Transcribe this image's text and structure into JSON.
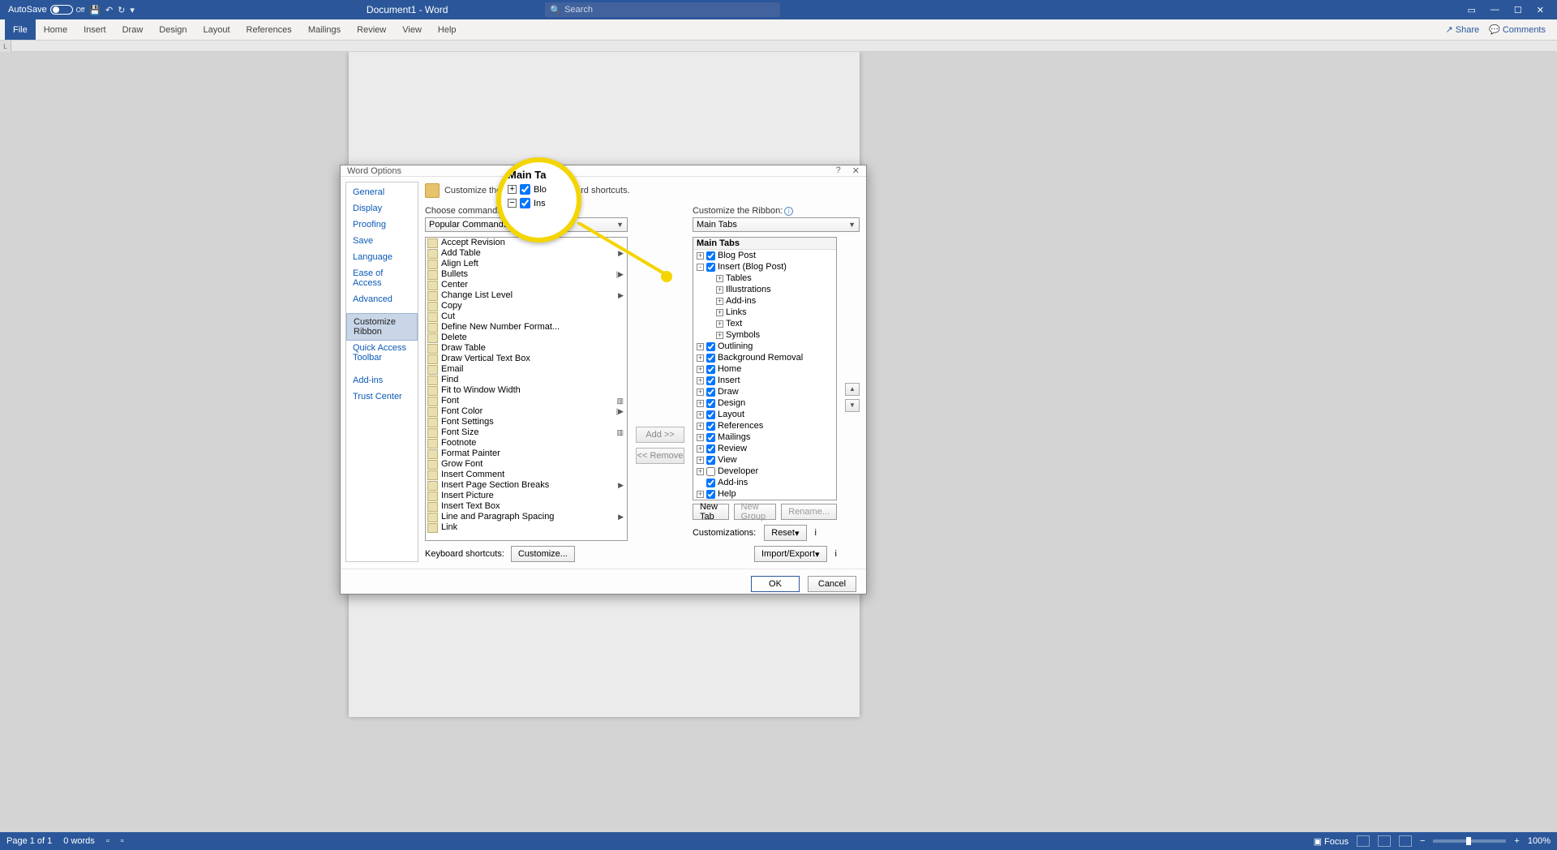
{
  "titlebar": {
    "autosave_label": "AutoSave",
    "autosave_state": "Off",
    "doc_title": "Document1 - Word",
    "search_placeholder": "Search"
  },
  "ribbon": {
    "tabs": [
      "File",
      "Home",
      "Insert",
      "Draw",
      "Design",
      "Layout",
      "References",
      "Mailings",
      "Review",
      "View",
      "Help"
    ],
    "share": "Share",
    "comments": "Comments"
  },
  "dialog": {
    "title": "Word Options",
    "nav": [
      "General",
      "Display",
      "Proofing",
      "Save",
      "Language",
      "Ease of Access",
      "Advanced",
      "Customize Ribbon",
      "Quick Access Toolbar",
      "Add-ins",
      "Trust Center"
    ],
    "nav_selected": "Customize Ribbon",
    "heading": "Customize the Ribbon and keyboard shortcuts.",
    "choose_label": "Choose commands from:",
    "choose_value": "Popular Commands",
    "customize_ribbon_label": "Customize the Ribbon:",
    "customize_ribbon_value": "Main Tabs",
    "commands": [
      {
        "label": "Accept Revision"
      },
      {
        "label": "Add Table",
        "sub": "▶"
      },
      {
        "label": "Align Left"
      },
      {
        "label": "Bullets",
        "sub": "|▶"
      },
      {
        "label": "Center"
      },
      {
        "label": "Change List Level",
        "sub": "▶"
      },
      {
        "label": "Copy"
      },
      {
        "label": "Cut"
      },
      {
        "label": "Define New Number Format..."
      },
      {
        "label": "Delete"
      },
      {
        "label": "Draw Table"
      },
      {
        "label": "Draw Vertical Text Box"
      },
      {
        "label": "Email"
      },
      {
        "label": "Find"
      },
      {
        "label": "Fit to Window Width"
      },
      {
        "label": "Font",
        "sub": "▥"
      },
      {
        "label": "Font Color",
        "sub": "|▶"
      },
      {
        "label": "Font Settings"
      },
      {
        "label": "Font Size",
        "sub": "▥"
      },
      {
        "label": "Footnote"
      },
      {
        "label": "Format Painter"
      },
      {
        "label": "Grow Font"
      },
      {
        "label": "Insert Comment"
      },
      {
        "label": "Insert Page  Section Breaks",
        "sub": "▶"
      },
      {
        "label": "Insert Picture"
      },
      {
        "label": "Insert Text Box"
      },
      {
        "label": "Line and Paragraph Spacing",
        "sub": "▶"
      },
      {
        "label": "Link"
      }
    ],
    "tree_header": "Main Tabs",
    "tree": [
      {
        "exp": "+",
        "chk": true,
        "label": "Blog Post",
        "indent": 0
      },
      {
        "exp": "-",
        "chk": true,
        "label": "Insert (Blog Post)",
        "indent": 0
      },
      {
        "exp": "+",
        "label": "Tables",
        "indent": 1
      },
      {
        "exp": "+",
        "label": "Illustrations",
        "indent": 1
      },
      {
        "exp": "+",
        "label": "Add-ins",
        "indent": 1
      },
      {
        "exp": "+",
        "label": "Links",
        "indent": 1
      },
      {
        "exp": "+",
        "label": "Text",
        "indent": 1
      },
      {
        "exp": "+",
        "label": "Symbols",
        "indent": 1
      },
      {
        "exp": "+",
        "chk": true,
        "label": "Outlining",
        "indent": 0
      },
      {
        "exp": "+",
        "chk": true,
        "label": "Background Removal",
        "indent": 0
      },
      {
        "exp": "+",
        "chk": true,
        "label": "Home",
        "indent": 0
      },
      {
        "exp": "+",
        "chk": true,
        "label": "Insert",
        "indent": 0
      },
      {
        "exp": "+",
        "chk": true,
        "label": "Draw",
        "indent": 0
      },
      {
        "exp": "+",
        "chk": true,
        "label": "Design",
        "indent": 0
      },
      {
        "exp": "+",
        "chk": true,
        "label": "Layout",
        "indent": 0
      },
      {
        "exp": "+",
        "chk": true,
        "label": "References",
        "indent": 0
      },
      {
        "exp": "+",
        "chk": true,
        "label": "Mailings",
        "indent": 0
      },
      {
        "exp": "+",
        "chk": true,
        "label": "Review",
        "indent": 0
      },
      {
        "exp": "+",
        "chk": true,
        "label": "View",
        "indent": 0
      },
      {
        "exp": "+",
        "chk": false,
        "label": "Developer",
        "indent": 0
      },
      {
        "chk": true,
        "label": "Add-ins",
        "indent": 0,
        "noexp": true
      },
      {
        "exp": "+",
        "chk": true,
        "label": "Help",
        "indent": 0
      }
    ],
    "add_btn": "Add >>",
    "remove_btn": "<< Remove",
    "new_tab": "New Tab",
    "new_group": "New Group",
    "rename": "Rename...",
    "customizations_label": "Customizations:",
    "reset": "Reset",
    "import_export": "Import/Export",
    "kbd_label": "Keyboard shortcuts:",
    "customize_btn": "Customize...",
    "ok": "OK",
    "cancel": "Cancel"
  },
  "magnifier": {
    "header": "Main Ta",
    "row1": "Blo",
    "row2": "Ins"
  },
  "status": {
    "page": "Page 1 of 1",
    "words": "0 words",
    "focus": "Focus",
    "zoom": "100%"
  }
}
